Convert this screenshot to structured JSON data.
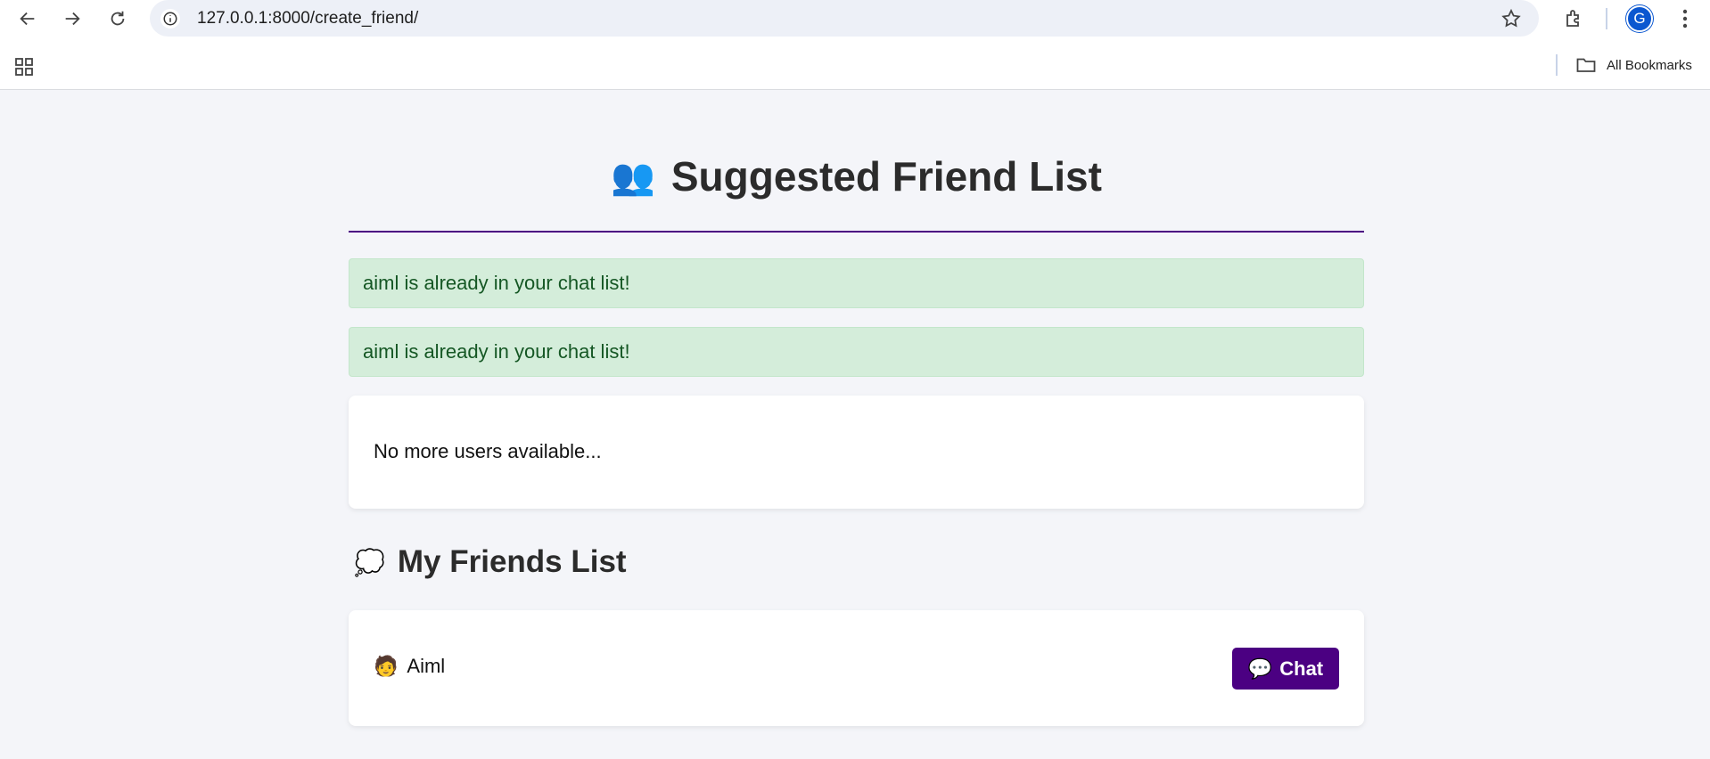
{
  "browser": {
    "url": "127.0.0.1:8000/create_friend/",
    "profile_initial": "G",
    "bookmarks_label": "All Bookmarks"
  },
  "page": {
    "title": "Suggested Friend List",
    "title_icon": "👥",
    "alerts": [
      "aiml is already in your chat list!",
      "aiml is already in your chat list!"
    ],
    "empty_message": "No more users available...",
    "friends_heading": "My Friends List",
    "friends_icon": "💭",
    "friends": [
      {
        "avatar": "🧑",
        "name": "Aiml",
        "chat_icon": "💬",
        "chat_label": "Chat"
      }
    ]
  },
  "colors": {
    "accent": "#4b0082",
    "alert_bg": "#d4edda",
    "alert_text": "#155724",
    "page_bg": "#f4f5f9"
  }
}
